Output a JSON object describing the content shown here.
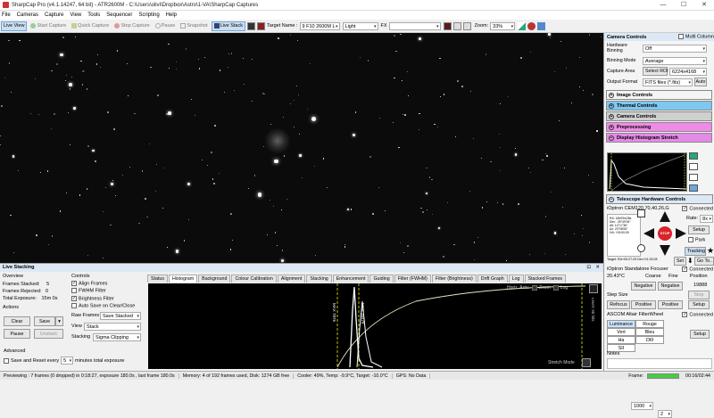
{
  "window": {
    "title": "SharpCap Pro (v4.1.14247, 64 bit) - ATR2600M - C:\\Users\\olivi\\Dropbox\\Astro\\1-VA\\SharpCap Captures",
    "minimize": "—",
    "maximize": "☐",
    "close": "✕"
  },
  "menu": [
    "File",
    "Cameras",
    "Capture",
    "View",
    "Tools",
    "Sequencer",
    "Scripting",
    "Help"
  ],
  "toolbar": {
    "live_view": "Live View",
    "start_capture": "Start Capture",
    "quick_capture": "Quick Capture",
    "stop_capture": "Stop Capture",
    "pause": "Pause",
    "snapshot": "Snapshot",
    "live_stack": "Live Stack",
    "target_name_label": "Target Name :",
    "target_name_value": "9 F10 2600M L",
    "frame_type": "Light",
    "fx_label": "FX",
    "fx_value": "",
    "zoom_label": "Zoom:",
    "zoom_value": "33%"
  },
  "camera_controls": {
    "title": "Camera Controls",
    "multi_column": "Multi Column",
    "hardware_binning_label": "Hardware Binning",
    "hardware_binning_value": "Off",
    "binning_mode_label": "Binning Mode",
    "binning_mode_value": "Average",
    "capture_area_label": "Capture Area",
    "select_roi": "Select ROI",
    "capture_area_value": "6224x4168",
    "output_format_label": "Output Format",
    "output_format_value": "FITS files (*.fits)",
    "auto": "Auto"
  },
  "sections": {
    "image": "Image Controls",
    "thermal": "Thermal Controls",
    "camera": "Camera Controls",
    "preprocessing": "Preprocessing",
    "display_histogram": "Display Histogram Stretch",
    "telescope": "Telescope Hardware Controls"
  },
  "colors": {
    "thermal": "#7ec8f0",
    "camera": "#cfcfcf",
    "preprocessing": "#f08ae8",
    "display_histogram": "#e58ae8",
    "telescope": "#dce8f5",
    "accent": "#6aa6e0",
    "stop": "#d8232a",
    "filter_selected": "#cce4ff"
  },
  "telescope": {
    "mount": "iOptron CEM120,70,40,26,G",
    "connected": "Connected",
    "rate_label": "Rate:",
    "rate_value": "8x",
    "setup": "Setup",
    "park": "Park",
    "tracking": "Tracking",
    "stop": "STOP",
    "set": "Set",
    "goto": "Go To..",
    "coords": [
      "RA: 16h09m28s",
      "Dec: -39°49'54\"",
      "Alt: 14°17'36\"",
      "Az: 23°08'06\"",
      "HA: +00:00:00"
    ],
    "footer": "Target: RA+00:27:25 Dec+01:25:28"
  },
  "focuser": {
    "name": "iOptron Standalone Focuser",
    "connected": "Connected",
    "temperature": "20.43°C",
    "coarse": "Coarse",
    "fine": "Fine",
    "position_label": "Position",
    "negative": "Negative",
    "position_value": "19888",
    "step_size_label": "Step Size",
    "step_size_value": "1000",
    "fine_value": "2",
    "stop": "Stop",
    "refocus": "Refocus",
    "positive": "Positive",
    "setup": "Setup"
  },
  "filterwheel": {
    "name": "ASCOM Altair FilterWheel",
    "connected": "Connected",
    "filters": [
      "Luminance",
      "Rouge",
      "Vert",
      "Bleu",
      "Ha",
      "OIII",
      "SII"
    ],
    "setup": "Setup"
  },
  "notes_label": "Notes",
  "live_stacking": {
    "title": "Live Stacking",
    "overview_label": "Overview",
    "frames_stacked_label": "Frames Stacked:",
    "frames_stacked_value": "5",
    "frames_rejected_label": "Frames Rejected:",
    "frames_rejected_value": "0",
    "total_exposure_label": "Total Exposure:",
    "total_exposure_value": "15m 0s",
    "actions_label": "Actions",
    "clear": "Clear",
    "save": "Save",
    "pause": "Pause",
    "unstack": "Unstack",
    "advanced_label": "Advanced",
    "save_reset_label": "Save and Reset every",
    "save_reset_value": "5",
    "save_reset_suffix": "minutes total exposure",
    "controls_label": "Controls",
    "align_frames": "Align Frames",
    "fwhm_filter": "FWHM Filter",
    "brightness_filter": "Brightness Filter",
    "auto_save": "Auto Save on Clear/Close",
    "raw_frames_label": "Raw Frames",
    "raw_frames_value": "Save Stacked",
    "view_label": "View",
    "view_value": "Stack",
    "stacking_label": "Stacking",
    "stacking_value": "Sigma Clipping",
    "tabs": [
      "Status",
      "Histogram",
      "Background",
      "Colour Calibration",
      "Alignment",
      "Stacking",
      "Enhancement",
      "Guiding",
      "Filter (FWHM)",
      "Filter (Brightness)",
      "Drift Graph",
      "Log",
      "Stacked Frames"
    ],
    "horiz_axis": "Horiz. Axis:",
    "zoom": "Zoom",
    "log": "Log",
    "max_label": "MAX 7876",
    "max2_label": "MAX 16478",
    "level_label": "Level: 95 hits",
    "stretch_mode": "Stretch Mode"
  },
  "status": {
    "previewing": "Previewing : 7 frames (0 dropped) in 0:18:27, exposure 180.0s , last frame 180.0s",
    "memory": "Memory: 4 of 192 frames used, Disk: 1274 GB free",
    "cooler": "Cooler: 49%, Temp: -9.9°C, Target: -10.0°C",
    "gps": "GPS: No Data",
    "frame_label": "Frame:",
    "frame_time": "00:16/02:44"
  }
}
